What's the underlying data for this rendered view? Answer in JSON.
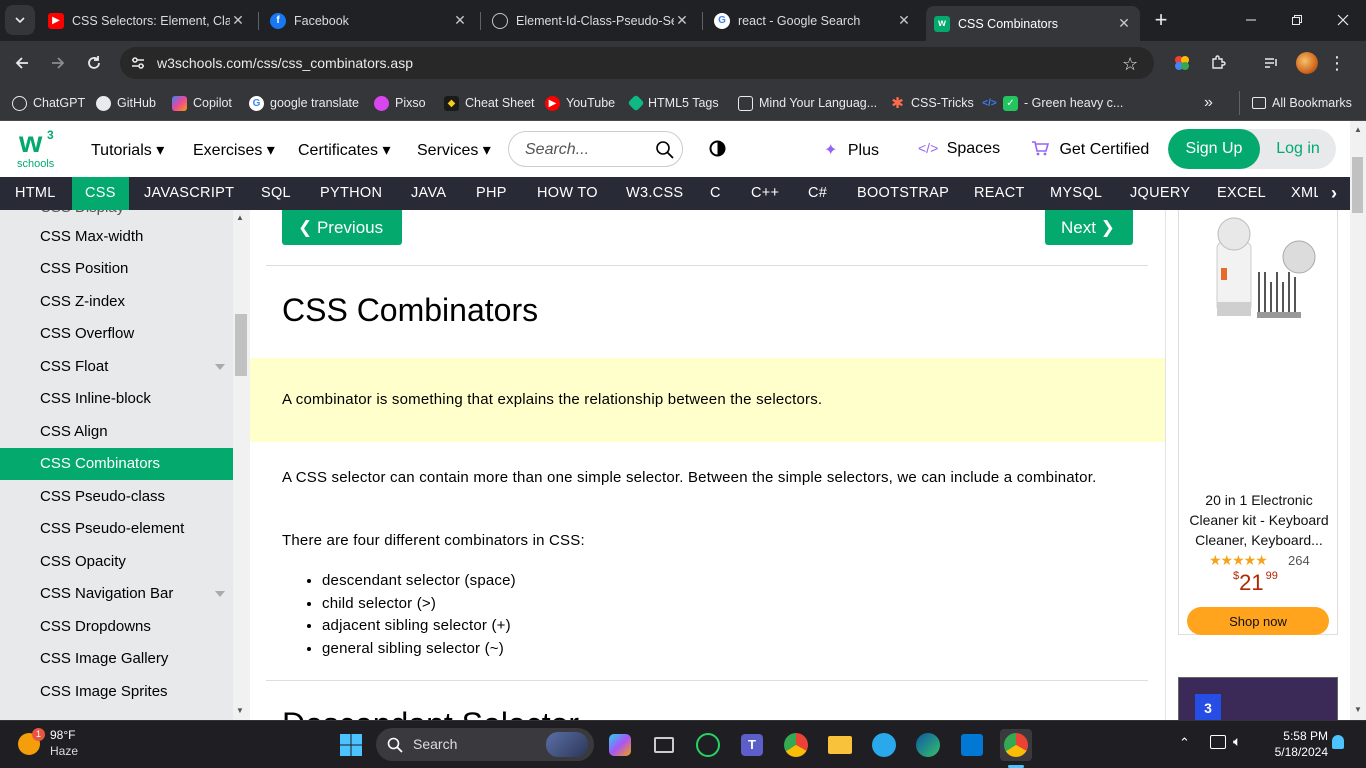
{
  "browser": {
    "tabs": [
      {
        "title": "CSS Selectors: Element, Class",
        "icon": "youtube-icon"
      },
      {
        "title": "Facebook",
        "icon": "facebook-icon"
      },
      {
        "title": "Element-Id-Class-Pseudo-Se",
        "icon": "globe-icon"
      },
      {
        "title": "react - Google Search",
        "icon": "google-icon"
      },
      {
        "title": "CSS Combinators",
        "icon": "w3schools-icon"
      }
    ],
    "url": "w3schools.com/css/css_combinators.asp",
    "bookmarks": [
      "ChatGPT",
      "GitHub",
      "Copilot",
      "google translate",
      "Pixso",
      "Cheat Sheet",
      "YouTube",
      "HTML5 Tags",
      "Mind Your Languag...",
      "CSS-Tricks",
      "- Green heavy c..."
    ],
    "all_bookmarks": "All Bookmarks"
  },
  "w3": {
    "logo_text": "schools",
    "logo_w": "w",
    "logo_sup": "3",
    "menu": [
      "Tutorials",
      "Exercises",
      "Certificates",
      "Services"
    ],
    "search_placeholder": "Search...",
    "plus": "Plus",
    "spaces": "Spaces",
    "get_certified": "Get Certified",
    "sign_up": "Sign Up",
    "log_in": "Log in",
    "subjects": [
      "HTML",
      "CSS",
      "JAVASCRIPT",
      "SQL",
      "PYTHON",
      "JAVA",
      "PHP",
      "HOW TO",
      "W3.CSS",
      "C",
      "C++",
      "C#",
      "BOOTSTRAP",
      "REACT",
      "MYSQL",
      "JQUERY",
      "EXCEL",
      "XML"
    ],
    "active_subject": "CSS",
    "accent": "#04AA6D"
  },
  "sidebar": {
    "items": [
      "CSS Max-width",
      "CSS Position",
      "CSS Z-index",
      "CSS Overflow",
      "CSS Float",
      "CSS Inline-block",
      "CSS Align",
      "CSS Combinators",
      "CSS Pseudo-class",
      "CSS Pseudo-element",
      "CSS Opacity",
      "CSS Navigation Bar",
      "CSS Dropdowns",
      "CSS Image Gallery",
      "CSS Image Sprites"
    ],
    "active": "CSS Combinators"
  },
  "main": {
    "prev": "❮ Previous",
    "next": "Next ❯",
    "title": "CSS Combinators",
    "intro": "A combinator is something that explains the relationship between the selectors.",
    "para1": "A CSS selector can contain more than one simple selector. Between the simple selectors, we can include a combinator.",
    "para2": "There are four different combinators in CSS:",
    "combinators": [
      "descendant selector (space)",
      "child selector (>)",
      "adjacent sibling selector (+)",
      "general sibling selector (~)"
    ],
    "next_heading": "Descendant Selector"
  },
  "ad": {
    "title": "20 in 1 Electronic Cleaner kit - Keyboard Cleaner, Keyboard...",
    "rating_count": "264",
    "rating": 4.5,
    "price_currency": "$",
    "price_whole": "21",
    "price_cents": "99",
    "shop": "Shop now"
  },
  "taskbar": {
    "temp": "98°F",
    "weather": "Haze",
    "weather_badge": "1",
    "search": "Search",
    "time": "5:58 PM",
    "date": "5/18/2024"
  }
}
